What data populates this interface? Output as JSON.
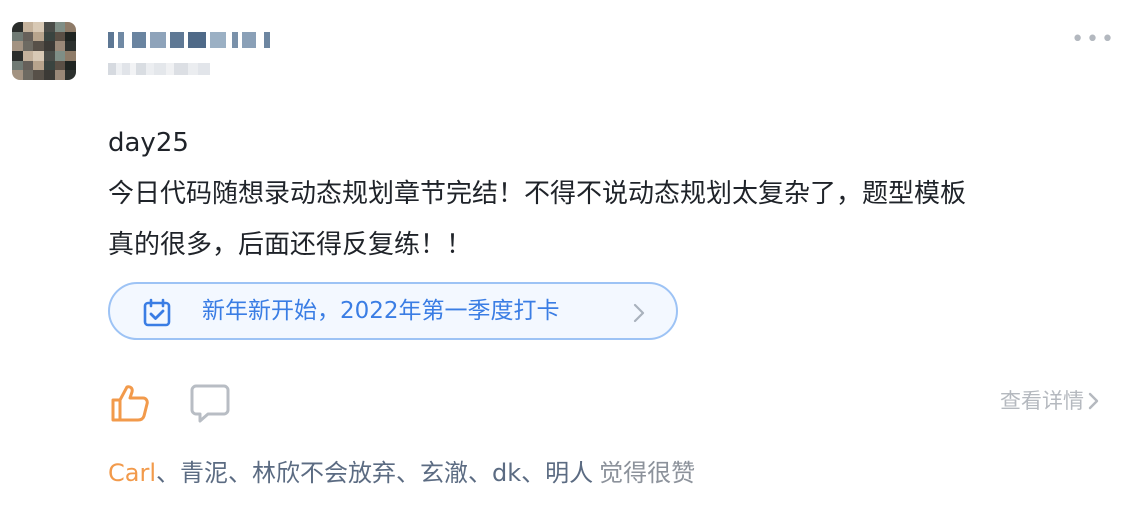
{
  "post": {
    "content_lines": [
      "day25",
      "今日代码随想录动态规划章节完结！不得不说动态规划太复杂了，题型模板",
      "真的很多，后面还得反复练！！"
    ]
  },
  "topic": {
    "label": "新年新开始，2022年第一季度打卡"
  },
  "actions": {
    "detail_label": "查看详情"
  },
  "likes": {
    "names": [
      "Carl",
      "青泥",
      "林欣不会放弃",
      "玄澈",
      "dk",
      "明人"
    ],
    "separator": "、",
    "suffix": "觉得很赞"
  },
  "colors": {
    "accent_blue": "#3a7de4",
    "like_orange": "#f29a4b",
    "muted": "#b5b9bf"
  },
  "icons": {
    "like": "thumbs-up-icon",
    "comment": "comment-bubble-icon",
    "topic": "calendar-check-icon",
    "more": "more-dots-icon"
  }
}
